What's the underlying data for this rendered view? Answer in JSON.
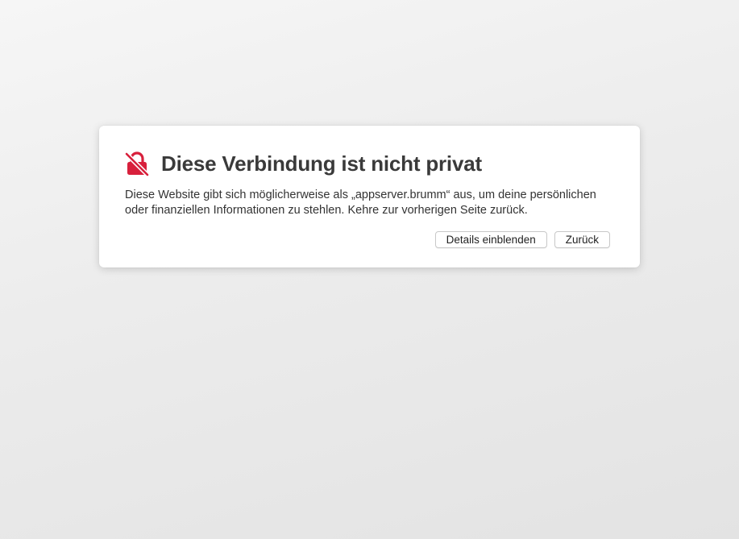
{
  "colors": {
    "accent": "#d8203c",
    "title": "#3a3a3a",
    "text": "#333333",
    "card": "#ffffff"
  },
  "warning": {
    "icon": "broken-lock-icon",
    "title": "Diese Verbindung ist nicht privat",
    "message": "Diese Website gibt sich möglicherweise als „appserver.brumm“ aus, um deine persönlichen oder finanziellen Informationen zu stehlen. Kehre zur vorherigen Seite zurück.",
    "buttons": {
      "details_label": "Details einblenden",
      "back_label": "Zurück"
    }
  }
}
